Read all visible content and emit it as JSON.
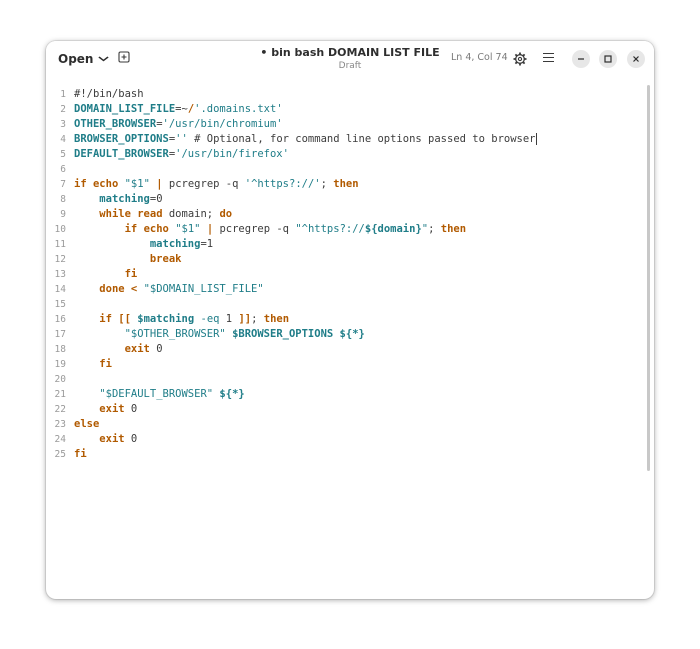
{
  "header": {
    "open_label": "Open",
    "title": "• bin bash DOMAIN LIST FILE",
    "subtitle": "Draft",
    "cursor_position": "Ln 4, Col 74"
  },
  "icons": {
    "open_dropdown": "chevron-down-icon",
    "new_tab": "new-tab-icon",
    "settings": "gear-icon",
    "menu": "hamburger-icon",
    "minimize": "minimize-icon",
    "maximize": "maximize-icon",
    "close": "close-icon"
  },
  "colors": {
    "keyword": "#b15a00",
    "variable": "#1f7d88",
    "string": "#1f7d88",
    "text": "#3c3c3c",
    "line_number": "#9a9a9a"
  },
  "lines": [
    [
      [
        "#!/bin/bash",
        "t"
      ]
    ],
    [
      [
        "DOMAIN_LIST_FILE",
        "v"
      ],
      [
        "=~",
        "t"
      ],
      [
        "/",
        "k"
      ],
      [
        "'.domains.txt'",
        "s"
      ]
    ],
    [
      [
        "OTHER_BROWSER",
        "v"
      ],
      [
        "=",
        "t"
      ],
      [
        "'/usr/bin/chromium'",
        "s"
      ]
    ],
    [
      [
        "BROWSER_OPTIONS",
        "v"
      ],
      [
        "=",
        "t"
      ],
      [
        "''",
        "s"
      ],
      [
        " # Optional, for command line options passed to browser",
        "t"
      ]
    ],
    [
      [
        "DEFAULT_BROWSER",
        "v"
      ],
      [
        "=",
        "t"
      ],
      [
        "'/usr/bin/firefox'",
        "s"
      ]
    ],
    [],
    [
      [
        "if",
        "k"
      ],
      [
        " ",
        "t"
      ],
      [
        "echo",
        "k"
      ],
      [
        " ",
        "t"
      ],
      [
        "\"$1\"",
        "s"
      ],
      [
        " ",
        "t"
      ],
      [
        "|",
        "k"
      ],
      [
        " pcregrep -q ",
        "t"
      ],
      [
        "'^https?://'",
        "s"
      ],
      [
        "; ",
        "t"
      ],
      [
        "then",
        "k"
      ]
    ],
    [
      [
        "    ",
        "t"
      ],
      [
        "matching",
        "v"
      ],
      [
        "=0",
        "t"
      ]
    ],
    [
      [
        "    ",
        "t"
      ],
      [
        "while",
        "k"
      ],
      [
        " ",
        "t"
      ],
      [
        "read",
        "k"
      ],
      [
        " domain; ",
        "t"
      ],
      [
        "do",
        "k"
      ]
    ],
    [
      [
        "        ",
        "t"
      ],
      [
        "if",
        "k"
      ],
      [
        " ",
        "t"
      ],
      [
        "echo",
        "k"
      ],
      [
        " ",
        "t"
      ],
      [
        "\"$1\"",
        "s"
      ],
      [
        " ",
        "t"
      ],
      [
        "|",
        "k"
      ],
      [
        " pcregrep -q ",
        "t"
      ],
      [
        "\"^https?://",
        "s"
      ],
      [
        "${domain}",
        "v"
      ],
      [
        "\"",
        "s"
      ],
      [
        "; ",
        "t"
      ],
      [
        "then",
        "k"
      ]
    ],
    [
      [
        "            ",
        "t"
      ],
      [
        "matching",
        "v"
      ],
      [
        "=1",
        "t"
      ]
    ],
    [
      [
        "            ",
        "t"
      ],
      [
        "break",
        "k"
      ]
    ],
    [
      [
        "        ",
        "t"
      ],
      [
        "fi",
        "k"
      ]
    ],
    [
      [
        "    ",
        "t"
      ],
      [
        "done",
        "k"
      ],
      [
        " ",
        "t"
      ],
      [
        "<",
        "k"
      ],
      [
        " ",
        "t"
      ],
      [
        "\"$DOMAIN_LIST_FILE\"",
        "s"
      ]
    ],
    [],
    [
      [
        "    ",
        "t"
      ],
      [
        "if",
        "k"
      ],
      [
        " ",
        "t"
      ],
      [
        "[[",
        "k"
      ],
      [
        " ",
        "t"
      ],
      [
        "$matching",
        "v"
      ],
      [
        " ",
        "t"
      ],
      [
        "-eq",
        "s"
      ],
      [
        " 1 ",
        "t"
      ],
      [
        "]]",
        "k"
      ],
      [
        "; ",
        "t"
      ],
      [
        "then",
        "k"
      ]
    ],
    [
      [
        "        ",
        "t"
      ],
      [
        "\"$OTHER_BROWSER\"",
        "s"
      ],
      [
        " ",
        "t"
      ],
      [
        "$BROWSER_OPTIONS",
        "v"
      ],
      [
        " ",
        "t"
      ],
      [
        "${*}",
        "v"
      ]
    ],
    [
      [
        "        ",
        "t"
      ],
      [
        "exit",
        "k"
      ],
      [
        " 0",
        "t"
      ]
    ],
    [
      [
        "    ",
        "t"
      ],
      [
        "fi",
        "k"
      ]
    ],
    [],
    [
      [
        "    ",
        "t"
      ],
      [
        "\"$DEFAULT_BROWSER\"",
        "s"
      ],
      [
        " ",
        "t"
      ],
      [
        "${*}",
        "v"
      ]
    ],
    [
      [
        "    ",
        "t"
      ],
      [
        "exit",
        "k"
      ],
      [
        " 0",
        "t"
      ]
    ],
    [
      [
        "else",
        "k"
      ]
    ],
    [
      [
        "    ",
        "t"
      ],
      [
        "exit",
        "k"
      ],
      [
        " 0",
        "t"
      ]
    ],
    [
      [
        "fi",
        "k"
      ]
    ]
  ]
}
